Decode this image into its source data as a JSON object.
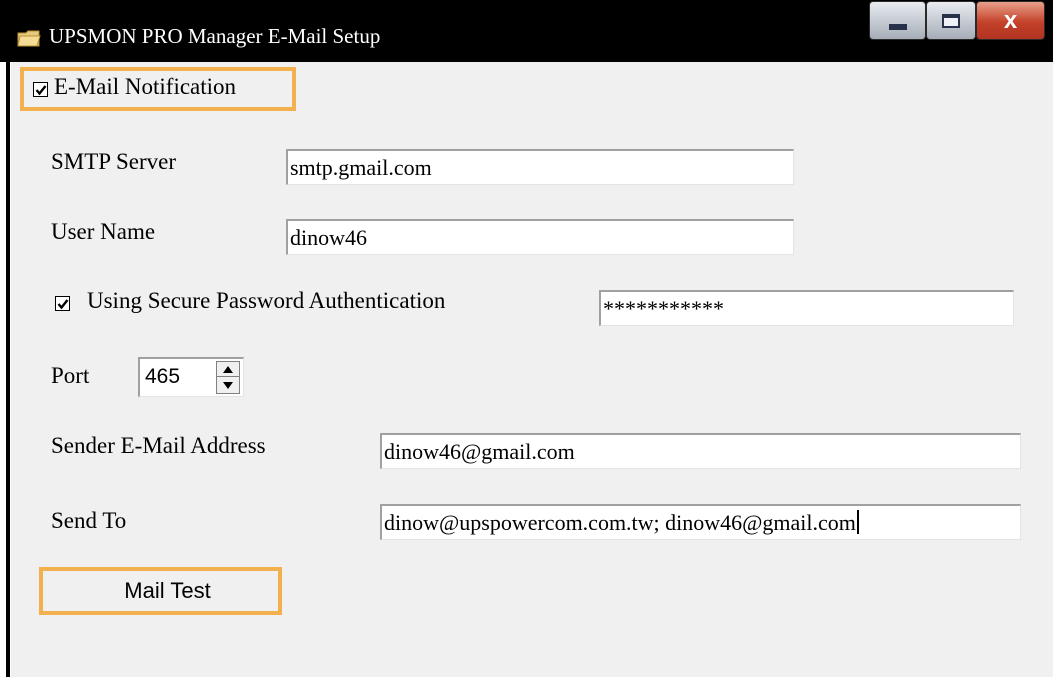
{
  "window": {
    "title": "UPSMON PRO Manager E-Mail Setup",
    "icon": "app-folder-icon",
    "controls": {
      "minimize": "minimize-icon",
      "maximize": "maximize-icon",
      "close": "close-icon"
    },
    "close_glyph": "x"
  },
  "email_notification": {
    "label": "E-Mail Notification",
    "checked": true
  },
  "smtp_server": {
    "label": "SMTP Server",
    "value": "smtp.gmail.com"
  },
  "user_name": {
    "label": "User Name",
    "value": "dinow46"
  },
  "secure_auth": {
    "label": "Using Secure Password Authentication",
    "checked": true,
    "password": "***********"
  },
  "port": {
    "label": "Port",
    "value": "465"
  },
  "sender": {
    "label": "Sender E-Mail Address",
    "value": "dinow46@gmail.com"
  },
  "send_to": {
    "label": "Send To",
    "value": "dinow@upspowercom.com.tw; dinow46@gmail.com"
  },
  "mail_test": {
    "label": "Mail Test"
  },
  "colors": {
    "highlight": "#f2b04f",
    "titlebar": "#000000",
    "dialog_bg": "#f0f0f0",
    "close_button": "#c4412a"
  }
}
